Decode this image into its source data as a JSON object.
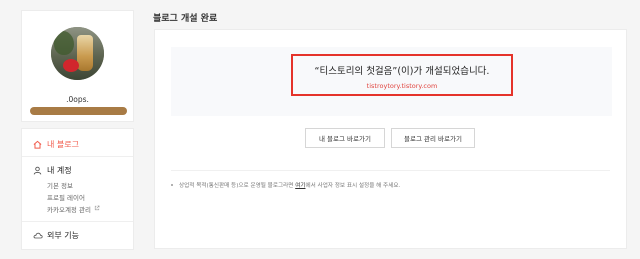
{
  "profile": {
    "username": ".0ops."
  },
  "sidebar": {
    "my_blog": "내 블로그",
    "my_account": "내 계정",
    "account_items": [
      "기본 정보",
      "프로필 레이어",
      "카카오계정 관리"
    ],
    "external": "외부 기능"
  },
  "page": {
    "title": "블로그 개설 완료"
  },
  "result": {
    "message": "“티스토리의 첫걸음”(이)가 개설되었습니다.",
    "url": "tistroytory.tistory.com"
  },
  "buttons": {
    "my_blog": "내 블로그 바로가기",
    "manage_blog": "블로그 관리 바로가기"
  },
  "notice": {
    "before": "상업적 목적(통신판매 등)으로 운영될 블로그라면 ",
    "link": "여기",
    "after": "에서 사업자 정보 표시 설정을 해 주세요."
  },
  "colors": {
    "accent": "#f15a4a",
    "highlight_border": "#e5332a"
  }
}
